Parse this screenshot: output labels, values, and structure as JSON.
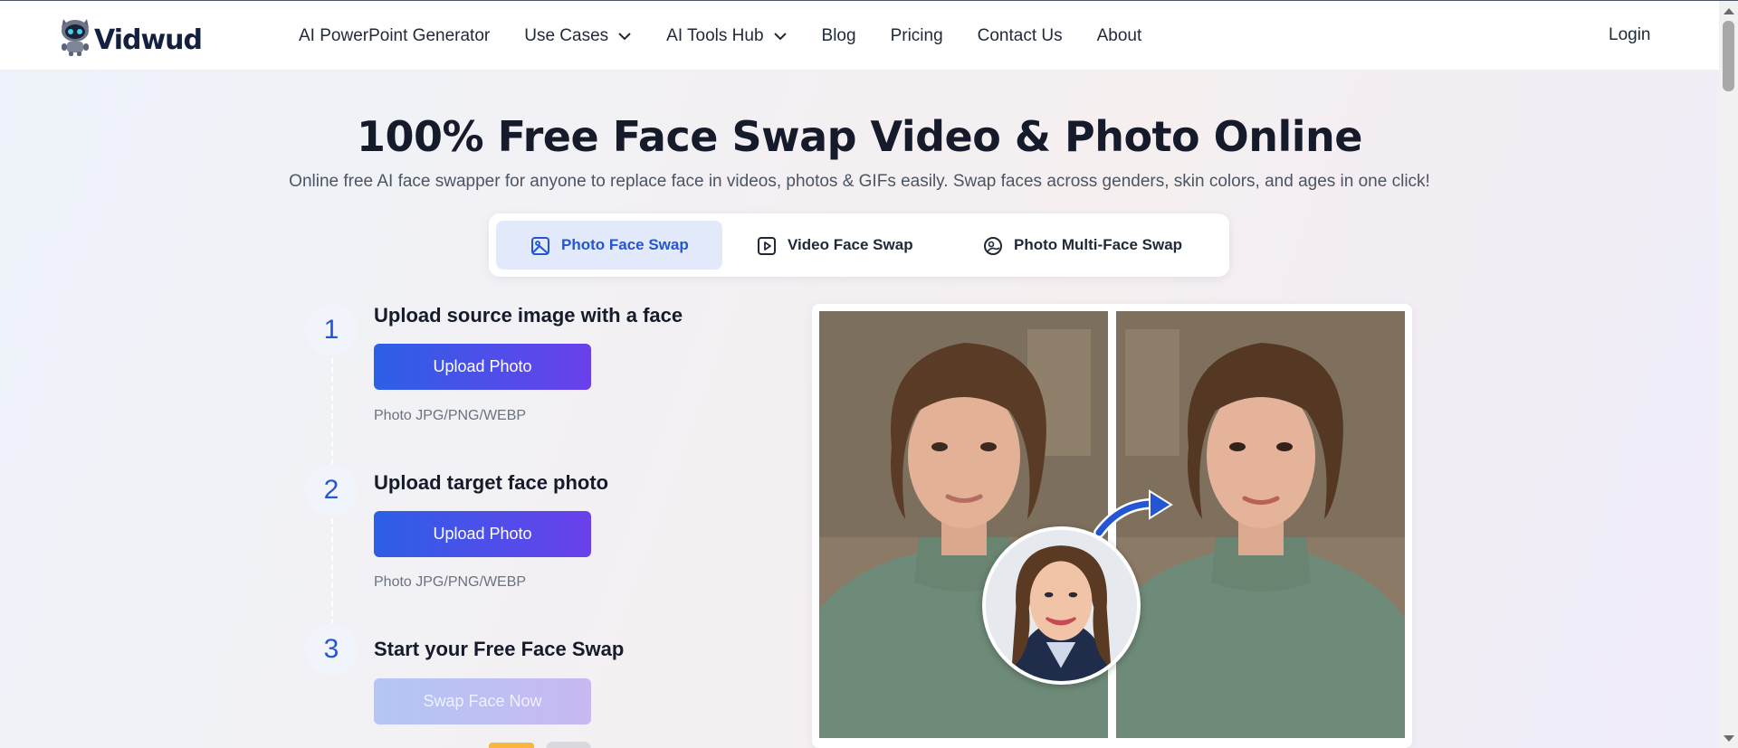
{
  "brand": {
    "name": "Vidwud"
  },
  "nav": {
    "items": [
      {
        "label": "AI PowerPoint Generator",
        "dropdown": false
      },
      {
        "label": "Use Cases",
        "dropdown": true
      },
      {
        "label": "AI Tools Hub",
        "dropdown": true
      },
      {
        "label": "Blog",
        "dropdown": false
      },
      {
        "label": "Pricing",
        "dropdown": false
      },
      {
        "label": "Contact Us",
        "dropdown": false
      },
      {
        "label": "About",
        "dropdown": false
      }
    ],
    "login": "Login"
  },
  "hero": {
    "title": "100% Free Face Swap Video & Photo Online",
    "subtitle": "Online free AI face swapper for anyone to replace face in videos, photos & GIFs easily. Swap faces across genders, skin colors, and ages in one click!"
  },
  "tabs": [
    {
      "label": "Photo Face Swap",
      "icon": "image-icon",
      "active": true
    },
    {
      "label": "Video Face Swap",
      "icon": "video-play-icon",
      "active": false
    },
    {
      "label": "Photo Multi-Face Swap",
      "icon": "multi-face-icon",
      "active": false
    }
  ],
  "steps": [
    {
      "number": "1",
      "title": "Upload source image with a face",
      "button": "Upload Photo",
      "formats": "Photo JPG/PNG/WEBP"
    },
    {
      "number": "2",
      "title": "Upload target face photo",
      "button": "Upload Photo",
      "formats": "Photo JPG/PNG/WEBP"
    },
    {
      "number": "3",
      "title": "Start your Free Face Swap",
      "button": "Swap Face Now"
    }
  ],
  "colors": {
    "accent": "#2456d4",
    "button_gradient_start": "#2d5fe6",
    "button_gradient_end": "#6a40ec",
    "tab_active_bg": "#e1e9fb"
  }
}
